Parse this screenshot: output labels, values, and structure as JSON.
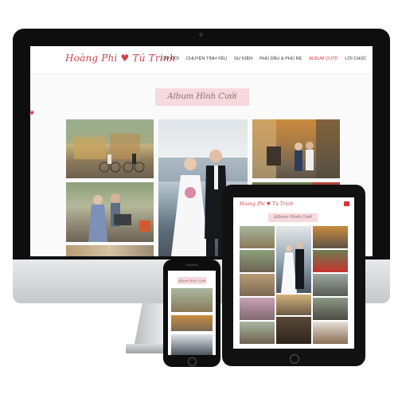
{
  "site": {
    "logo_text": "Hoàng Phi ♥ Tú Trinh",
    "menu": [
      {
        "label": "CẶP ĐÔI",
        "active": false
      },
      {
        "label": "CHUYỆN TÌNH YÊU",
        "active": false
      },
      {
        "label": "SỰ KIỆN",
        "active": false
      },
      {
        "label": "PHÙ DÂU & PHÙ RỂ",
        "active": false
      },
      {
        "label": "ALBUM CƯỚI",
        "active": true
      },
      {
        "label": "LỜI CHÚC",
        "active": false
      }
    ],
    "album_title": "Album Hình Cưới"
  },
  "colors": {
    "accent": "#d9343f",
    "logo": "#c7464e",
    "banner_bg": "#f6d9dc",
    "frame": "#0e0e0f"
  }
}
